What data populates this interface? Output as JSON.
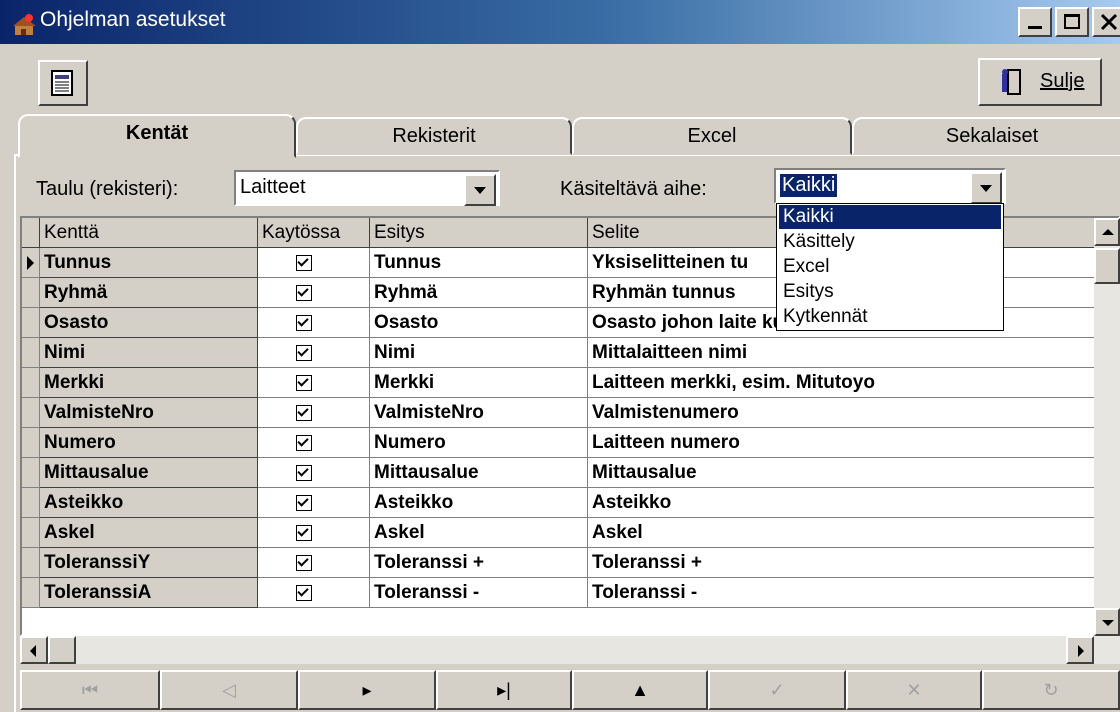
{
  "window": {
    "title": "Ohjelman asetukset"
  },
  "toolbar": {
    "close_label": "Sulje"
  },
  "tabs": [
    "Kentät",
    "Rekisterit",
    "Excel",
    "Sekalaiset"
  ],
  "filters": {
    "table_label": "Taulu (rekisteri):",
    "table_value": "Laitteet",
    "topic_label": "Käsiteltävä aihe:",
    "topic_value": "Kaikki",
    "topic_options": [
      "Kaikki",
      "Käsittely",
      "Excel",
      "Esitys",
      "Kytkennät"
    ]
  },
  "grid": {
    "columns": [
      "Kenttä",
      "Kaytössa",
      "Esitys",
      "Selite"
    ],
    "rows": [
      {
        "field": "Tunnus",
        "enabled": true,
        "display": "Tunnus",
        "description": "Yksiselitteinen tu"
      },
      {
        "field": "Ryhmä",
        "enabled": true,
        "display": "Ryhmä",
        "description": "Ryhmän tunnus"
      },
      {
        "field": "Osasto",
        "enabled": true,
        "display": "Osasto",
        "description": "Osasto johon laite kuuluu"
      },
      {
        "field": "Nimi",
        "enabled": true,
        "display": "Nimi",
        "description": "Mittalaitteen nimi"
      },
      {
        "field": "Merkki",
        "enabled": true,
        "display": "Merkki",
        "description": "Laitteen merkki, esim. Mitutoyo"
      },
      {
        "field": "ValmisteNro",
        "enabled": true,
        "display": "ValmisteNro",
        "description": "Valmistenumero"
      },
      {
        "field": "Numero",
        "enabled": true,
        "display": "Numero",
        "description": "Laitteen numero"
      },
      {
        "field": "Mittausalue",
        "enabled": true,
        "display": "Mittausalue",
        "description": "Mittausalue"
      },
      {
        "field": "Asteikko",
        "enabled": true,
        "display": "Asteikko",
        "description": "Asteikko"
      },
      {
        "field": "Askel",
        "enabled": true,
        "display": "Askel",
        "description": "Askel"
      },
      {
        "field": "ToleranssiY",
        "enabled": true,
        "display": "Toleranssi +",
        "description": "Toleranssi +"
      },
      {
        "field": "ToleranssiA",
        "enabled": true,
        "display": "Toleranssi -",
        "description": "Toleranssi -"
      }
    ]
  },
  "colors": {
    "titlebar": "#0a246a",
    "selection": "#0a246a",
    "face": "#d4d0c8"
  }
}
